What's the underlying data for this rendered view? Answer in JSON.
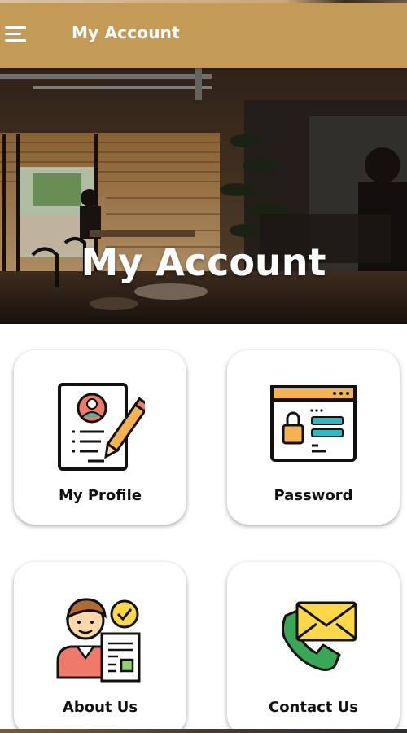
{
  "header": {
    "title": "My Account",
    "menu_icon": "hamburger-menu-icon",
    "background_color": "#c39a56"
  },
  "hero": {
    "title": "My Account",
    "image": "cafe-interior-photo"
  },
  "tiles": [
    {
      "label": "My Profile",
      "icon": "profile-document-icon"
    },
    {
      "label": "Password",
      "icon": "password-window-icon"
    },
    {
      "label": "About Us",
      "icon": "about-person-icon"
    },
    {
      "label": "Contact Us",
      "icon": "phone-envelope-icon"
    }
  ],
  "colors": {
    "accent": "#c39a56",
    "icon_orange": "#f4b253",
    "icon_teal": "#2fb7c2",
    "icon_red": "#f07a6a",
    "icon_yellow": "#ffd84a",
    "icon_green": "#3aa757"
  }
}
